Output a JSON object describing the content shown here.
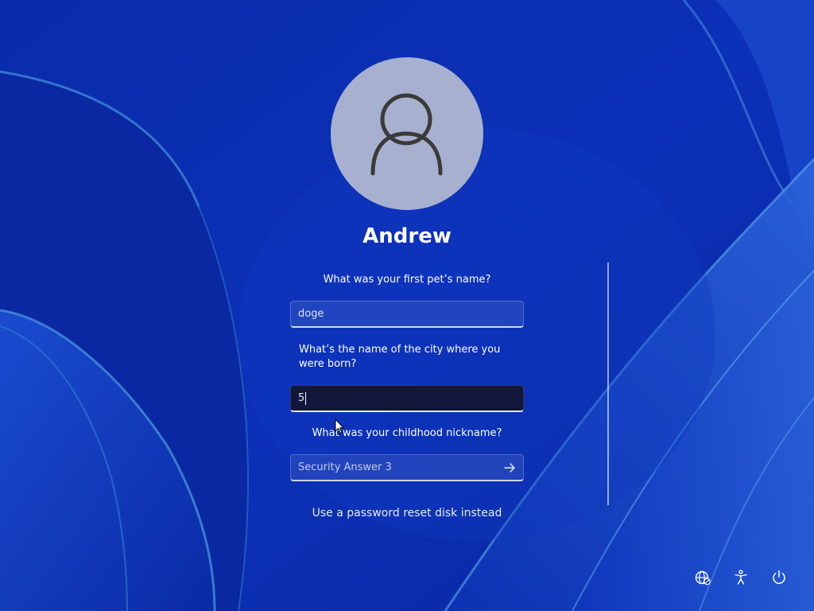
{
  "user": {
    "name": "Andrew"
  },
  "security": {
    "questions": [
      {
        "label": "What was your first pet’s name?",
        "answer": "doge",
        "placeholder": ""
      },
      {
        "label": "What’s the name of the city where you were born?",
        "answer": "5",
        "placeholder": ""
      },
      {
        "label": "What was your childhood nickname?",
        "answer": "",
        "placeholder": "Security Answer 3"
      }
    ]
  },
  "links": {
    "reset_disk": "Use a password reset disk instead"
  },
  "system_buttons": {
    "network_icon": "network-globe-icon",
    "accessibility_icon": "accessibility-icon",
    "power_icon": "power-icon"
  },
  "colors": {
    "background_blue": "#0b2fb0",
    "avatar_fill": "#a7b0cf",
    "text": "#ffffff"
  }
}
